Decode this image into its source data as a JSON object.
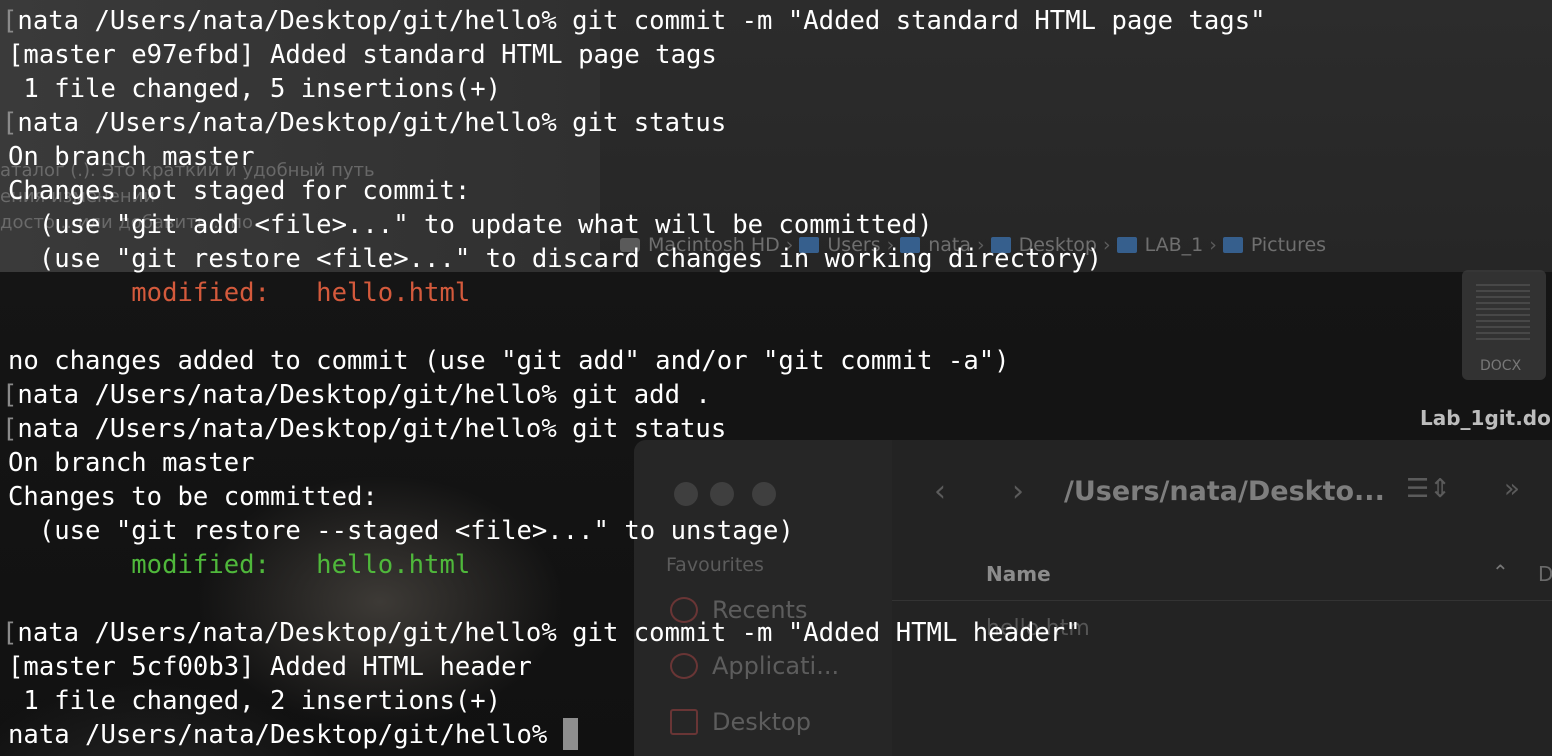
{
  "background": {
    "doc_lines": [
      "аталог (.). Это краткий и удобный путь",
      "ения изменений",
      "досто... или добавить... по"
    ],
    "pathbar": [
      "Macintosh HD",
      "Users",
      "nata",
      "Desktop",
      "LAB_1",
      "Pictures"
    ],
    "file_icon_tag": "DOCX",
    "file_name": "Lab_1git.do",
    "finder": {
      "title": "/Users/nata/Deskto...",
      "favourites_title": "Favourites",
      "favourites": [
        "Recents",
        "Applicati...",
        "Desktop"
      ],
      "column_name": "Name",
      "column_d": "D",
      "row_file": "hello.htm"
    }
  },
  "terminal": {
    "prompt": "nata /Users/nata/Desktop/git/hello% ",
    "lines": [
      {
        "kind": "cmd",
        "text": "git commit -m \"Added standard HTML page tags\""
      },
      {
        "kind": "out",
        "text": "[master e97efbd] Added standard HTML page tags"
      },
      {
        "kind": "out",
        "text": " 1 file changed, 5 insertions(+)"
      },
      {
        "kind": "cmd",
        "text": "git status"
      },
      {
        "kind": "out",
        "text": "On branch master"
      },
      {
        "kind": "out",
        "text": "Changes not staged for commit:"
      },
      {
        "kind": "out",
        "text": "  (use \"git add <file>...\" to update what will be committed)"
      },
      {
        "kind": "out",
        "text": "  (use \"git restore <file>...\" to discard changes in working directory)"
      },
      {
        "kind": "red",
        "text": "        modified:   hello.html"
      },
      {
        "kind": "out",
        "text": ""
      },
      {
        "kind": "out",
        "text": "no changes added to commit (use \"git add\" and/or \"git commit -a\")"
      },
      {
        "kind": "cmd",
        "text": "git add ."
      },
      {
        "kind": "cmd",
        "text": "git status"
      },
      {
        "kind": "out",
        "text": "On branch master"
      },
      {
        "kind": "out",
        "text": "Changes to be committed:"
      },
      {
        "kind": "out",
        "text": "  (use \"git restore --staged <file>...\" to unstage)"
      },
      {
        "kind": "green",
        "text": "        modified:   hello.html"
      },
      {
        "kind": "out",
        "text": ""
      },
      {
        "kind": "cmd",
        "text": "git commit -m \"Added HTML header\""
      },
      {
        "kind": "out",
        "text": "[master 5cf00b3] Added HTML header"
      },
      {
        "kind": "out",
        "text": " 1 file changed, 2 insertions(+)"
      },
      {
        "kind": "current",
        "text": ""
      }
    ]
  }
}
